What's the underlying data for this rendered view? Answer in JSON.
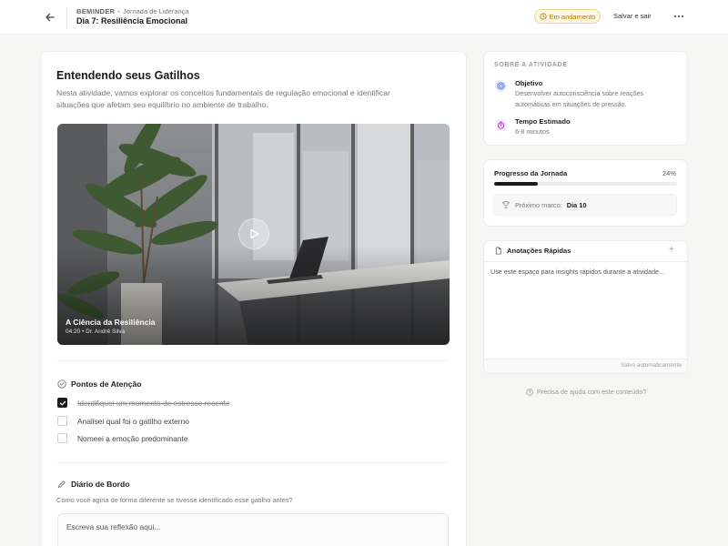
{
  "header": {
    "breadcrumb_brand": "BEMINDER",
    "breadcrumb_separator": "•",
    "breadcrumb_section": "Jornada de Liderança",
    "title": "Dia 7: Resiliência Emocional",
    "status_badge": "Em andamento",
    "save_exit_label": "Salvar e sair",
    "more_icon": "more-horizontal-icon"
  },
  "main": {
    "section_title": "Entendendo seus Gatilhos",
    "section_description": "Nesta atividade, vamos explorar os conceitos fundamentais de regulação emocional e identificar situações que afetam seu equilíbrio no ambiente de trabalho.",
    "video": {
      "title": "A Ciência da Resiliência",
      "meta": "04:20 • Dr. André Silva"
    },
    "attention": {
      "heading": "Pontos de Atenção",
      "items": [
        {
          "label": "Identifiquei um momento de estresse recente",
          "checked": true
        },
        {
          "label": "Analisei qual foi o gatilho externo",
          "checked": false
        },
        {
          "label": "Nomeei a emoção predominante",
          "checked": false
        }
      ]
    },
    "diary": {
      "heading": "Diário de Bordo",
      "question": "Como você agiria de forma diferente se tivesse identificado esse gatilho antes?",
      "placeholder": "Escreva sua reflexão aqui..."
    }
  },
  "sidebar": {
    "about": {
      "label": "SOBRE A ATIVIDADE",
      "objective_title": "Objetivo",
      "objective_text": "Desenvolver autoconsciência sobre reações automáticas em situações de pressão.",
      "time_title": "Tempo Estimado",
      "time_text": "6-8 minutos"
    },
    "progress": {
      "label": "Progresso da Jornada",
      "percent_text": "24%",
      "percent_value": 24,
      "milestone_label": "Próximo marco:",
      "milestone_value": "Dia 10"
    },
    "notes": {
      "title": "Anotações Rápidas",
      "add_label": "+",
      "placeholder": "Use este espaço para insights rápidos durante a atividade...",
      "saved_text": "Salvo automaticamente"
    },
    "help_text": "Precisa de ajuda com este conteúdo?"
  },
  "colors": {
    "accent": "#1a1a1a",
    "status_text": "#b57400",
    "status_bg": "#fff8e6",
    "objective_icon": "#4a6cf7",
    "time_icon": "#c026d3"
  }
}
